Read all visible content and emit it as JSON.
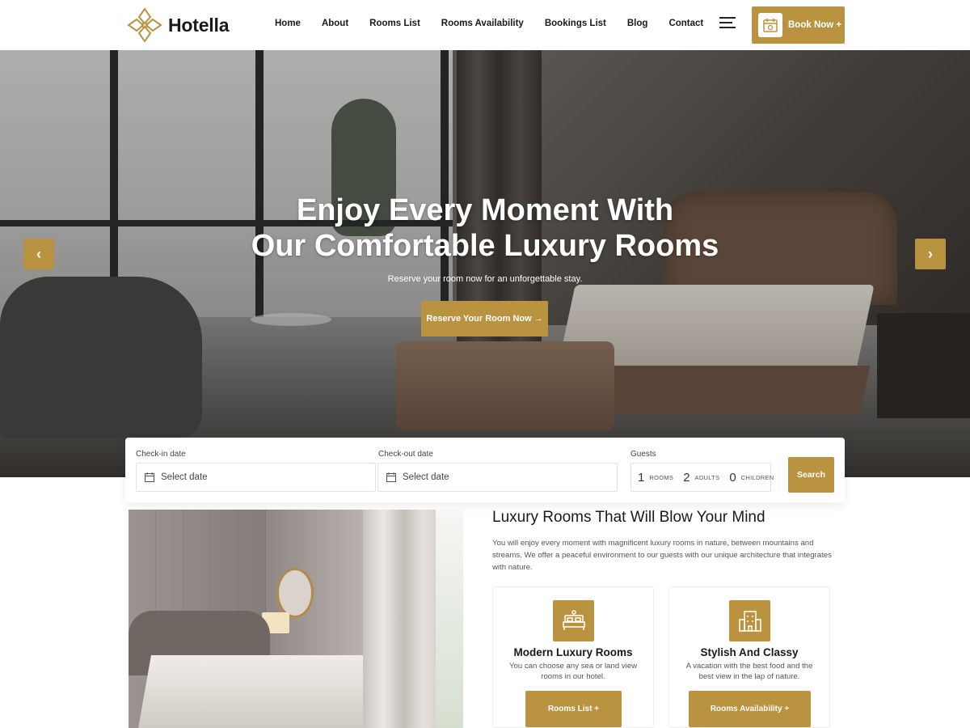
{
  "brand": {
    "name": "Hotella",
    "accent": "#b9933f"
  },
  "nav": {
    "items": [
      {
        "label": "Home"
      },
      {
        "label": "About"
      },
      {
        "label": "Rooms List"
      },
      {
        "label": "Rooms Availability"
      },
      {
        "label": "Bookings List"
      },
      {
        "label": "Blog"
      },
      {
        "label": "Contact"
      }
    ],
    "menu_icon": "hamburger-icon",
    "book_now": {
      "label": "Book Now +",
      "icon": "calendar-icon"
    }
  },
  "hero": {
    "title_line1": "Enjoy Every Moment With",
    "title_line2": "Our Comfortable Luxury Rooms",
    "subtitle": "Reserve your room now for an unforgettable stay.",
    "cta": "Reserve Your Room Now →",
    "prev_arrow": "‹",
    "next_arrow": "›"
  },
  "booking": {
    "checkin": {
      "label": "Check-in date",
      "placeholder": "Select date"
    },
    "checkout": {
      "label": "Check-out date",
      "placeholder": "Select date"
    },
    "guests": {
      "label": "Guests",
      "rooms": {
        "value": "1",
        "label": "ROOMS"
      },
      "adults": {
        "value": "2",
        "label": "ADULTS"
      },
      "children": {
        "value": "0",
        "label": "CHILDREN"
      }
    },
    "search": "Search"
  },
  "about": {
    "title": "Luxury Rooms That Will Blow Your Mind",
    "text": "You will enjoy every moment with magnificent luxury rooms in nature, between mountains and streams. We offer a peaceful environment to our guests with our unique architecture that integrates with nature.",
    "cards": [
      {
        "icon": "bed-icon",
        "title": "Modern Luxury Rooms",
        "text": "You can choose any sea or land view rooms in our hotel.",
        "button": "Rooms List +"
      },
      {
        "icon": "building-icon",
        "title": "Stylish And Classy",
        "text": "A vacation with the best food and the best view in the lap of nature.",
        "button": "Rooms Availability +"
      }
    ]
  }
}
